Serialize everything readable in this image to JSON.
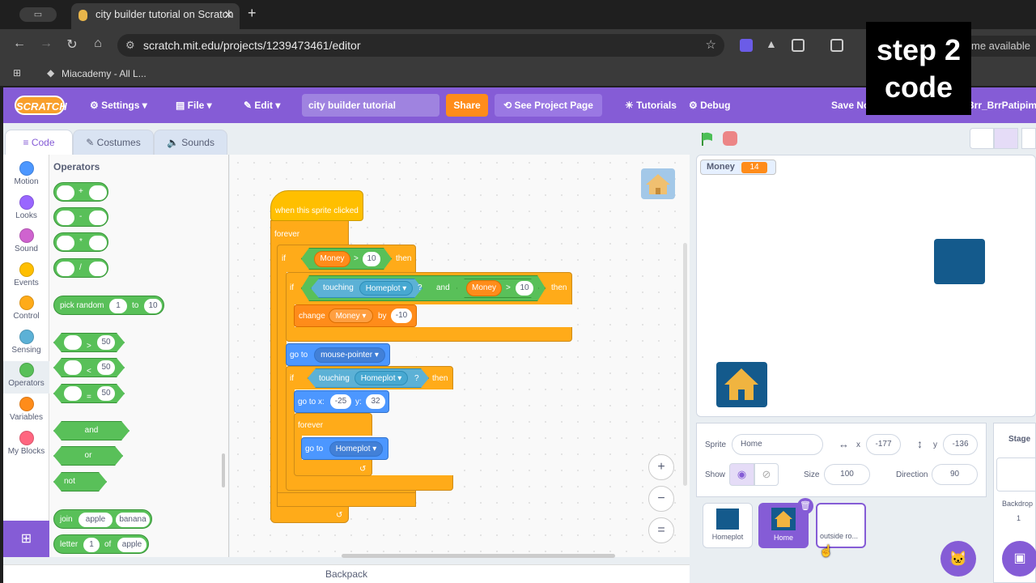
{
  "browser": {
    "tab_title": "city builder tutorial on Scratch",
    "url": "scratch.mit.edu/projects/1239473461/editor",
    "bookmark": "Miacademy - All L...",
    "profile_hint": "me available"
  },
  "overlay": {
    "line1": "step 2",
    "line2": "code"
  },
  "menubar": {
    "logo": "SCRATCH",
    "settings": "Settings",
    "file": "File",
    "edit": "Edit",
    "project_title": "city builder tutorial",
    "share": "Share",
    "see_project": "See Project Page",
    "tutorials": "Tutorials",
    "debug": "Debug",
    "save_now": "Save Now",
    "username": "Brr_BrrPatipim"
  },
  "editor_tabs": {
    "code": "Code",
    "costumes": "Costumes",
    "sounds": "Sounds"
  },
  "categories": [
    {
      "label": "Motion",
      "color": "#4c97ff"
    },
    {
      "label": "Looks",
      "color": "#9966ff"
    },
    {
      "label": "Sound",
      "color": "#cf63cf"
    },
    {
      "label": "Events",
      "color": "#ffbf00"
    },
    {
      "label": "Control",
      "color": "#ffab19"
    },
    {
      "label": "Sensing",
      "color": "#5cb1d6"
    },
    {
      "label": "Operators",
      "color": "#59c059"
    },
    {
      "label": "Variables",
      "color": "#ff8c1a"
    },
    {
      "label": "My Blocks",
      "color": "#ff6680"
    }
  ],
  "palette": {
    "title": "Operators",
    "add": "+",
    "sub": "-",
    "mul": "*",
    "div": "/",
    "pick_random": "pick random",
    "pr_from": "1",
    "pr_to_lbl": "to",
    "pr_to": "10",
    "gt": ">",
    "lt": "<",
    "eq": "=",
    "cmp_val": "50",
    "and": "and",
    "or": "or",
    "not": "not",
    "join": "join",
    "join_a": "apple",
    "join_b": "banana",
    "letter": "letter",
    "letter_n": "1",
    "letter_of": "of",
    "letter_s": "apple"
  },
  "script": {
    "hat": "when this sprite clicked",
    "forever": "forever",
    "if": "if",
    "then": "then",
    "money": "Money",
    "gt": ">",
    "ten": "10",
    "touching": "touching",
    "homeplot": "Homeplot",
    "q": "?",
    "and": "and",
    "change": "change",
    "by": "by",
    "neg10": "-10",
    "goto": "go to",
    "mouse": "mouse-pointer",
    "gotoxy": "go to x:",
    "xval": "-25",
    "ylbl": "y:",
    "yval": "32"
  },
  "workspace": {
    "zoom_in": "+",
    "zoom_out": "−",
    "reset": "="
  },
  "backpack": "Backpack",
  "stage": {
    "monitor_label": "Money",
    "monitor_value": "14"
  },
  "sprite_info": {
    "sprite_lbl": "Sprite",
    "sprite_name": "Home",
    "x_lbl": "x",
    "x": "-177",
    "y_lbl": "y",
    "y": "-136",
    "show_lbl": "Show",
    "size_lbl": "Size",
    "size": "100",
    "dir_lbl": "Direction",
    "dir": "90"
  },
  "sprites": [
    {
      "name": "Homeplot"
    },
    {
      "name": "Home"
    },
    {
      "name": "outside ro..."
    }
  ],
  "stage_col": {
    "title": "Stage",
    "backdrops": "Backdrop",
    "count": "1"
  }
}
